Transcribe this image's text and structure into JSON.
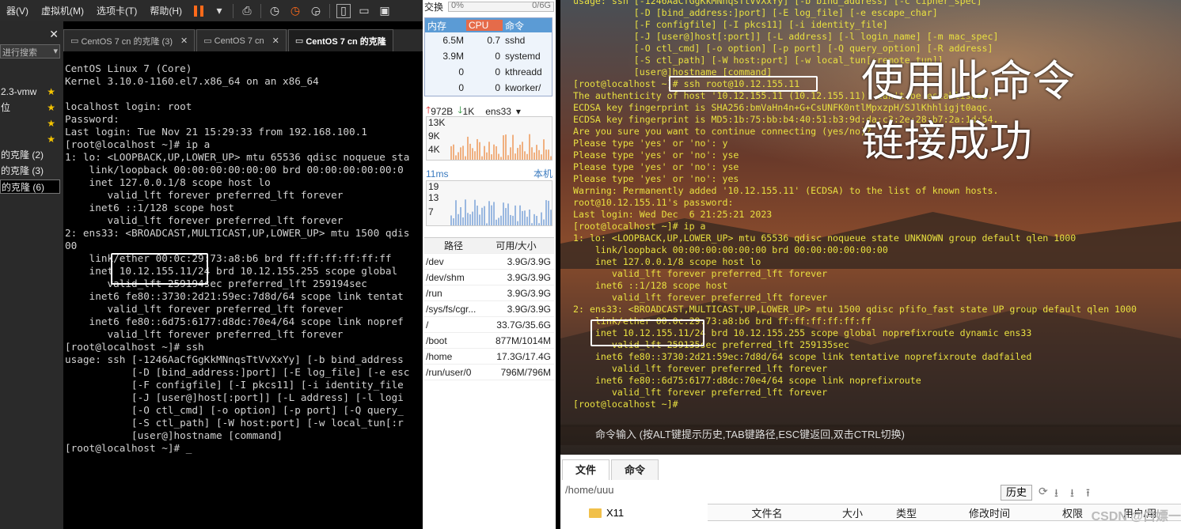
{
  "vm": {
    "menu": [
      "器(V)",
      "虚拟机(M)",
      "选项卡(T)",
      "帮助(H)"
    ],
    "search_placeholder": "进行搜索",
    "library": [
      {
        "label": "2.3-vmw",
        "star": true
      },
      {
        "label": "位",
        "star": true
      },
      {
        "label": "",
        "star": true
      },
      {
        "label": "",
        "star": true
      },
      {
        "label": "的克隆 (2)",
        "star": false
      },
      {
        "label": "的克隆 (3)",
        "star": false
      },
      {
        "label": "的克隆 (6)",
        "star": false
      }
    ],
    "tabs": [
      {
        "label": "CentOS 7 cn 的克隆 (3)",
        "active": false
      },
      {
        "label": "CentOS 7 cn",
        "active": false
      },
      {
        "label": "CentOS 7 cn 的克隆",
        "active": true
      }
    ],
    "console_text": "CentOS Linux 7 (Core)\nKernel 3.10.0-1160.el7.x86_64 on an x86_64\n\nlocalhost login: root\nPassword:\nLast login: Tue Nov 21 15:29:33 from 192.168.100.1\n[root@localhost ~]# ip a\n1: lo: <LOOPBACK,UP,LOWER_UP> mtu 65536 qdisc noqueue sta\n    link/loopback 00:00:00:00:00:00 brd 00:00:00:00:00:0\n    inet 127.0.0.1/8 scope host lo\n       valid_lft forever preferred_lft forever\n    inet6 ::1/128 scope host\n       valid_lft forever preferred_lft forever\n2: ens33: <BROADCAST,MULTICAST,UP,LOWER_UP> mtu 1500 qdis\n00\n    link/ether 00:0c:29:73:a8:b6 brd ff:ff:ff:ff:ff:ff\n    inet 10.12.155.11/24 brd 10.12.155.255 scope global \n       valid_lft 259194sec preferred_lft 259194sec\n    inet6 fe80::3730:2d21:59ec:7d8d/64 scope link tentat\n       valid_lft forever preferred_lft forever\n    inet6 fe80::6d75:6177:d8dc:70e4/64 scope link nopref\n       valid_lft forever preferred_lft forever\n[root@localhost ~]# ssh\nusage: ssh [-1246AaCfGgKkMNnqsTtVvXxYy] [-b bind_address\n           [-D [bind_address:]port] [-E log_file] [-e esc\n           [-F configfile] [-I pkcs11] [-i identity_file\n           [-J [user@]host[:port]] [-L address] [-l logi\n           [-O ctl_cmd] [-o option] [-p port] [-Q query_\n           [-S ctl_path] [-W host:port] [-w local_tun[:r\n           [user@]hostname [command]\n[root@localhost ~]# _"
  },
  "monitor": {
    "swap_label": "交换",
    "swap_pct": "0%",
    "swap_size": "0/6G",
    "swap_fraction": 0,
    "proc_headers": [
      "内存",
      "CPU",
      "命令"
    ],
    "processes": [
      {
        "mem": "6.5M",
        "cpu": "0.7",
        "cmd": "sshd"
      },
      {
        "mem": "3.9M",
        "cpu": "0",
        "cmd": "systemd"
      },
      {
        "mem": "0",
        "cpu": "0",
        "cmd": "kthreadd"
      },
      {
        "mem": "0",
        "cpu": "0",
        "cmd": "kworker/"
      }
    ],
    "net_up": "972B",
    "net_down": "1K",
    "net_iface": "ens33",
    "net_scale": [
      "13K",
      "9K",
      "4K"
    ],
    "latency": "11ms",
    "latency_target": "本机",
    "latency_scale": [
      "19",
      "13",
      "7"
    ],
    "disk_headers": [
      "路径",
      "可用/大小"
    ],
    "disks": [
      {
        "path": "/dev",
        "size": "3.9G/3.9G"
      },
      {
        "path": "/dev/shm",
        "size": "3.9G/3.9G"
      },
      {
        "path": "/run",
        "size": "3.9G/3.9G"
      },
      {
        "path": "/sys/fs/cgr...",
        "size": "3.9G/3.9G"
      },
      {
        "path": "/",
        "size": "33.7G/35.6G"
      },
      {
        "path": "/boot",
        "size": "877M/1014M"
      },
      {
        "path": "/home",
        "size": "17.3G/17.4G"
      },
      {
        "path": "/run/user/0",
        "size": "796M/796M"
      }
    ]
  },
  "terminal": {
    "text": "usage: ssh [-1246AaCfGgKkMNnqsTtVvXxYy] [-b bind_address] [-c cipher_spec]\n           [-D [bind_address:]port] [-E log_file] [-e escape_char]\n           [-F configfile] [-I pkcs11] [-i identity_file]\n           [-J [user@]host[:port]] [-L address] [-l login_name] [-m mac_spec]\n           [-O ctl_cmd] [-o option] [-p port] [-Q query_option] [-R address]\n           [-S ctl_path] [-W host:port] [-w local_tun[:remote_tun]]\n           [user@]hostname [command]\n[root@localhost ~]# ssh root@10.12.155.11\nThe authenticity of host '10.12.155.11 (10.12.155.11)' can't be established.\nECDSA key fingerprint is SHA256:bmVaHn4n+G+CsUNFK0ntlMpxzpH/SJlKhhligjt0aqc.\nECDSA key fingerprint is MD5:1b:75:bb:b4:40:51:b3:9d:da:c3:2e:28:b7:2a:1d:54.\nAre you sure you want to continue connecting (yes/no)?\nPlease type 'yes' or 'no': y\nPlease type 'yes' or 'no': yse\nPlease type 'yes' or 'no': yse\nPlease type 'yes' or 'no': yes\nWarning: Permanently added '10.12.155.11' (ECDSA) to the list of known hosts.\nroot@10.12.155.11's password:\nLast login: Wed Dec  6 21:25:21 2023\n[root@localhost ~]# ip a\n1: lo: <LOOPBACK,UP,LOWER_UP> mtu 65536 qdisc noqueue state UNKNOWN group default qlen 1000\n    link/loopback 00:00:00:00:00:00 brd 00:00:00:00:00:00\n    inet 127.0.0.1/8 scope host lo\n       valid_lft forever preferred_lft forever\n    inet6 ::1/128 scope host\n       valid_lft forever preferred_lft forever\n2: ens33: <BROADCAST,MULTICAST,UP,LOWER_UP> mtu 1500 qdisc pfifo_fast state UP group default qlen 1000\n    link/ether 00:0c:29:73:a8:b6 brd ff:ff:ff:ff:ff:ff\n    inet 10.12.155.11/24 brd 10.12.155.255 scope global noprefixroute dynamic ens33\n       valid_lft 259135sec preferred_lft 259135sec\n    inet6 fe80::3730:2d21:59ec:7d8d/64 scope link tentative noprefixroute dadfailed\n       valid_lft forever preferred_lft forever\n    inet6 fe80::6d75:6177:d8dc:70e4/64 scope link noprefixroute\n       valid_lft forever preferred_lft forever\n[root@localhost ~]#",
    "annotation_1": "使用此命令",
    "annotation_2": "链接成功",
    "cmd_hint": "命令输入 (按ALT键提示历史,TAB键路径,ESC键返回,双击CTRL切换)"
  },
  "files": {
    "tabs": [
      "文件",
      "命令"
    ],
    "path": "/home/uuu",
    "history_button": "历史",
    "columns": [
      "文件名",
      "大小",
      "类型",
      "修改时间",
      "权限",
      "用户/用"
    ],
    "folder": "X11",
    "watermark": "CSDN @白嫖一"
  },
  "colors": {
    "terminal_text": "#e8e040",
    "highlight_box": "#ffffff",
    "proc_header": "#5b9bd5"
  }
}
